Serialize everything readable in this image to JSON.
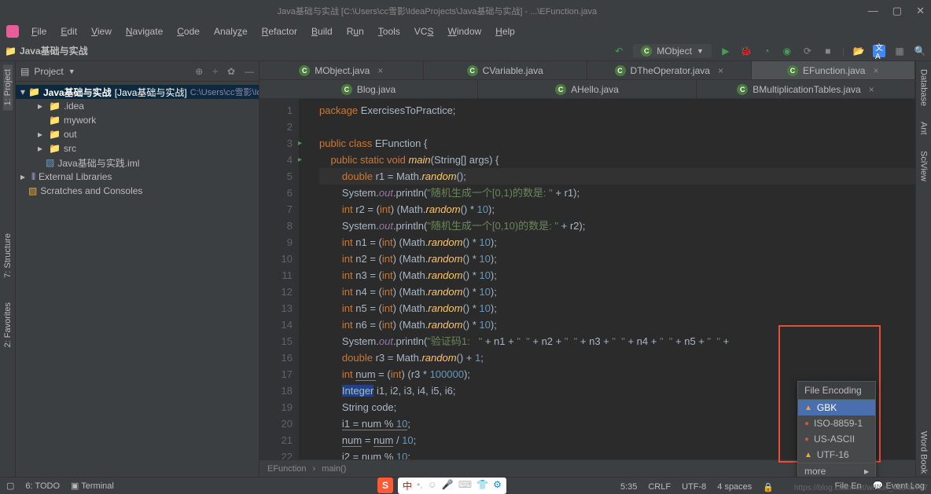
{
  "title": "Java基础与实战 [C:\\Users\\cc雪影\\IdeaProjects\\Java基础与实战] - ...\\EFunction.java",
  "menu": [
    "File",
    "Edit",
    "View",
    "Navigate",
    "Code",
    "Analyze",
    "Refactor",
    "Build",
    "Run",
    "Tools",
    "VCS",
    "Window",
    "Help"
  ],
  "breadcrumb": "Java基础与实战",
  "runConfig": "MObject",
  "projectPanel": {
    "title": "Project",
    "tree": {
      "root": {
        "label": "Java基础与实战",
        "hint": "[Java基础与实战]",
        "path": "C:\\Users\\cc雪影\\Ide"
      },
      "items": [
        {
          "label": ".idea",
          "type": "folder-grey",
          "indent": 1,
          "arrow": "▸"
        },
        {
          "label": "mywork",
          "type": "folder-grey",
          "indent": 1,
          "arrow": ""
        },
        {
          "label": "out",
          "type": "folder",
          "indent": 1,
          "arrow": "▸"
        },
        {
          "label": "src",
          "type": "folder",
          "indent": 1,
          "arrow": "▸"
        },
        {
          "label": "Java基础与实践.iml",
          "type": "file",
          "indent": 1,
          "arrow": ""
        }
      ],
      "external": "External Libraries",
      "scratches": "Scratches and Consoles"
    }
  },
  "tabs": {
    "row1": [
      {
        "label": "MObject.java",
        "closable": true
      },
      {
        "label": "CVariable.java",
        "closable": false
      },
      {
        "label": "DTheOperator.java",
        "closable": true
      },
      {
        "label": "EFunction.java",
        "closable": true,
        "active": true
      }
    ],
    "row2": [
      {
        "label": "Blog.java",
        "closable": false
      },
      {
        "label": "AHello.java",
        "closable": false
      },
      {
        "label": "BMultiplicationTables.java",
        "closable": true
      }
    ]
  },
  "editor": {
    "lines": [
      1,
      2,
      3,
      4,
      5,
      6,
      7,
      8,
      9,
      10,
      11,
      12,
      13,
      14,
      15,
      16,
      17,
      18,
      19,
      20,
      21,
      22
    ],
    "currentLine": 5,
    "breadcrumb": [
      "EFunction",
      "main()"
    ]
  },
  "encodingPopup": {
    "title": "File Encoding",
    "options": [
      {
        "label": "GBK",
        "icon": "warn",
        "selected": true
      },
      {
        "label": "ISO-8859-1",
        "icon": "err"
      },
      {
        "label": "US-ASCII",
        "icon": "err"
      },
      {
        "label": "UTF-16",
        "icon": "warn"
      }
    ],
    "more": "more"
  },
  "status": {
    "todo": "6: TODO",
    "terminal": "Terminal",
    "fileEnc": "File En",
    "eventLog": "Event Log",
    "pos": "5:35",
    "sep": "CRLF",
    "enc": "UTF-8",
    "indent": "4 spaces"
  },
  "sideTools": {
    "left": [
      "1: Project",
      "7: Structure",
      "2: Favorites"
    ],
    "right": [
      "Database",
      "Ant",
      "SciView",
      "Word Book"
    ]
  },
  "url": "https://blog.csdn.net/weixin_45843707"
}
